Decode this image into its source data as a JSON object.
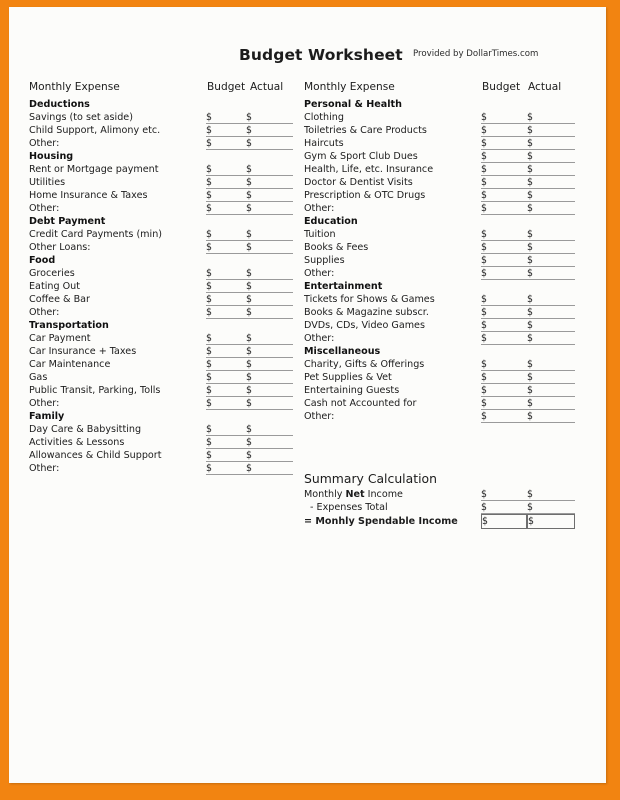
{
  "document": {
    "title": "Budget Worksheet",
    "provided_by": "Provided by DollarTimes.com"
  },
  "column_headers": {
    "expense": "Monthly Expense",
    "budget": "Budget",
    "actual": "Actual"
  },
  "currency_symbol": "$",
  "colors": {
    "frame_orange": "#f28411",
    "page": "#fcfcfa",
    "text": "#1c1c1c",
    "rule": "#9a9a9a"
  },
  "left_column": {
    "header_expense": "Monthly Expense",
    "header_budget": "Budget",
    "header_actual": "Actual",
    "sections": [
      {
        "title": "Deductions",
        "items": [
          "Savings (to set aside)",
          "Child Support, Alimony etc.",
          "Other:"
        ]
      },
      {
        "title": "Housing",
        "items": [
          "Rent or Mortgage payment",
          "Utilities",
          "Home Insurance & Taxes",
          "Other:"
        ]
      },
      {
        "title": "Debt Payment",
        "items": [
          "Credit Card Payments (min)",
          "Other Loans:"
        ]
      },
      {
        "title": "Food",
        "items": [
          "Groceries",
          "Eating Out",
          "Coffee & Bar",
          "Other:"
        ]
      },
      {
        "title": "Transportation",
        "items": [
          "Car Payment",
          "Car Insurance + Taxes",
          "Car Maintenance",
          "Gas",
          "Public Transit, Parking, Tolls",
          "Other:"
        ]
      },
      {
        "title": "Family",
        "items": [
          "Day Care & Babysitting",
          "Activities & Lessons",
          "Allowances & Child Support",
          "Other:"
        ]
      }
    ]
  },
  "right_column": {
    "header_expense": "Monthly Expense",
    "header_budget": "Budget",
    "header_actual": "Actual",
    "sections": [
      {
        "title": "Personal & Health",
        "items": [
          "Clothing",
          "Toiletries & Care Products",
          "Haircuts",
          "Gym & Sport Club Dues",
          "Health, Life, etc. Insurance",
          "Doctor & Dentist Visits",
          "Prescription & OTC Drugs",
          "Other:"
        ]
      },
      {
        "title": "Education",
        "items": [
          "Tuition",
          "Books & Fees",
          "Supplies",
          "Other:"
        ]
      },
      {
        "title": "Entertainment",
        "items": [
          "Tickets for Shows & Games",
          "Books & Magazine subscr.",
          "DVDs, CDs, Video Games",
          "Other:"
        ]
      },
      {
        "title": "Miscellaneous",
        "items": [
          "Charity, Gifts & Offerings",
          "Pet Supplies & Vet",
          "Entertaining Guests",
          "Cash not Accounted for",
          "Other:"
        ]
      }
    ]
  },
  "summary": {
    "title": "Summary Calculation",
    "rows": [
      {
        "prefix": "Monthly ",
        "emphasis": "Net",
        "suffix": " Income",
        "style": "mixed",
        "boxed": false
      },
      {
        "label": "- Expenses Total",
        "style": "indent",
        "boxed": false
      },
      {
        "label": "= Monhly Spendable Income",
        "style": "bold",
        "boxed": true
      }
    ]
  }
}
